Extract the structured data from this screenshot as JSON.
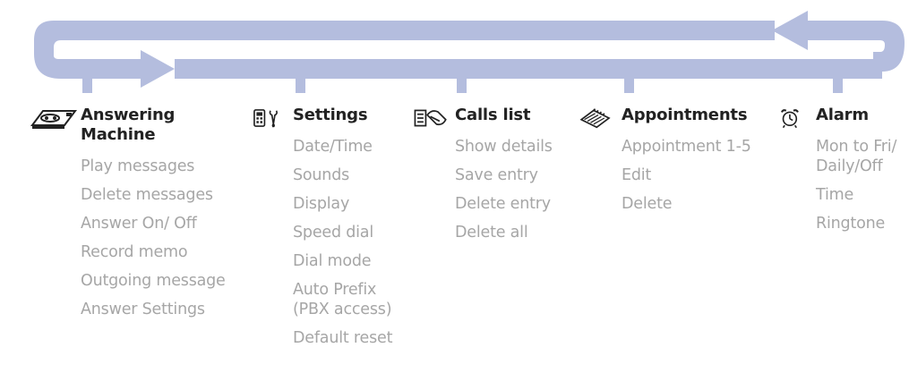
{
  "colors": {
    "loop": "#b4bdde",
    "heading": "#222222",
    "item": "#a6a6a6"
  },
  "menus": [
    {
      "icon": "answering-machine-icon",
      "title": "Answering Machine",
      "items": [
        "Play messages",
        "Delete messages",
        "Answer On/ Off",
        "Record memo",
        "Outgoing message",
        "Answer Settings"
      ]
    },
    {
      "icon": "settings-icon",
      "title": "Settings",
      "items": [
        "Date/Time",
        "Sounds",
        "Display",
        "Speed dial",
        "Dial mode",
        "Auto Prefix (PBX access)",
        "Default reset"
      ]
    },
    {
      "icon": "calls-list-icon",
      "title": "Calls list",
      "items": [
        "Show details",
        "Save entry",
        "Delete entry",
        "Delete all"
      ]
    },
    {
      "icon": "appointments-icon",
      "title": "Appointments",
      "items": [
        "Appointment 1-5",
        "Edit",
        "Delete"
      ]
    },
    {
      "icon": "alarm-icon",
      "title": "Alarm",
      "items": [
        "Mon to Fri/ Daily/Off",
        "Time",
        "Ringtone"
      ]
    }
  ]
}
